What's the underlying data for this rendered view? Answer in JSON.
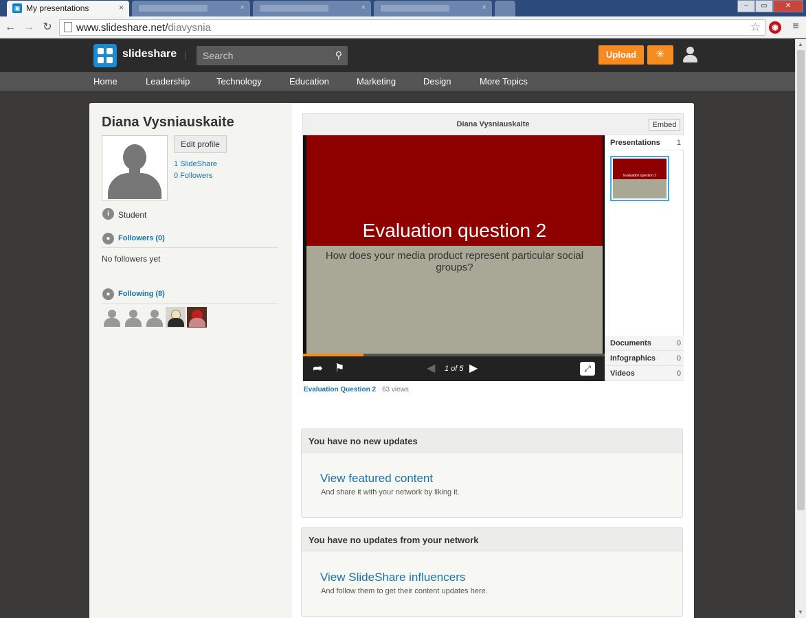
{
  "browser": {
    "active_tab_title": "My presentations",
    "tab_close": "×",
    "url_host": "www.slideshare.net/",
    "url_path": "diavysnia",
    "back": "←",
    "forward": "→",
    "reload": "↻",
    "star": "☆",
    "menu": "≡",
    "win_min": "–",
    "win_max": "▭",
    "win_close": "✕"
  },
  "header": {
    "logo_text": "slideshare",
    "search_placeholder": "Search",
    "upload_label": "Upload"
  },
  "topics": [
    "Home",
    "Leadership",
    "Technology",
    "Education",
    "Marketing",
    "Design",
    "More Topics"
  ],
  "profile": {
    "name": "Diana Vysniauskaite",
    "edit_label": "Edit profile",
    "slideshare_count": "1 SlideShare",
    "followers_count": "0 Followers",
    "role": "Student",
    "followers_title": "Followers (0)",
    "no_followers": "No followers yet",
    "following_title": "Following (8)"
  },
  "player": {
    "header_title": "Diana Vysniauskaite",
    "embed_label": "Embed",
    "slide_title": "Evaluation question 2",
    "slide_subtitle": "How does your media product represent particular social groups?",
    "page_indicator": "1 of 5",
    "progress": 0.2,
    "thumb_title": "Evaluation question 2",
    "side": {
      "presentations_label": "Presentations",
      "presentations_count": "1",
      "documents_label": "Documents",
      "documents_count": "0",
      "infographics_label": "Infographics",
      "infographics_count": "0",
      "videos_label": "Videos",
      "videos_count": "0"
    }
  },
  "presentation": {
    "link_label": "Evaluation Question 2",
    "views": "63 views"
  },
  "updates": [
    {
      "header": "You have no new updates",
      "link": "View featured content",
      "description": "And share it with your network by liking it."
    },
    {
      "header": "You have no updates from your network",
      "link": "View SlideShare influencers",
      "description": "And follow them to get their content updates here."
    }
  ],
  "colors": {
    "accent": "#f68b1f",
    "link": "#1a73a8",
    "brand": "#1b8bd0"
  }
}
